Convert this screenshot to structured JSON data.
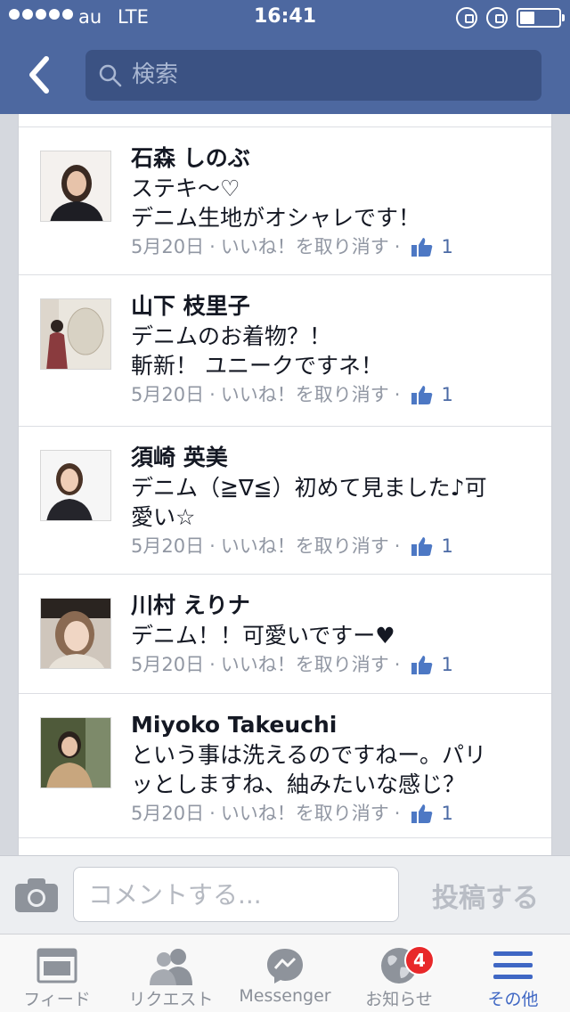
{
  "status_bar": {
    "carrier": "au",
    "network": "LTE",
    "time": "16:41"
  },
  "header": {
    "back_icon": "chevron-left-icon",
    "search_placeholder": "検索"
  },
  "comments": [
    {
      "name": "石森 しのぶ",
      "text": "ステキ〜♡\nデニム生地がオシャレです！",
      "date": "5月20日",
      "unlike_label": "いいね！を取り消す",
      "likes": "1"
    },
    {
      "name": "山下 枝里子",
      "text": "デニムのお着物？！\n斬新！ ユニークですネ！",
      "date": "5月20日",
      "unlike_label": "いいね！を取り消す",
      "likes": "1"
    },
    {
      "name": "須崎 英美",
      "text": "デニム（≧∇≦）初めて見ました♪可\n愛い☆",
      "date": "5月20日",
      "unlike_label": "いいね！を取り消す",
      "likes": "1"
    },
    {
      "name": "川村 えりナ",
      "text": "デニム！！可愛いですー♥",
      "date": "5月20日",
      "unlike_label": "いいね！を取り消す",
      "likes": "1"
    },
    {
      "name": "Miyoko Takeuchi",
      "text": "という事は洗えるのですねー。パリ\nッとしますね、紬みたいな感じ？",
      "date": "5月20日",
      "unlike_label": "いいね！を取り消す",
      "likes": "1"
    }
  ],
  "composer": {
    "placeholder": "コメントする...",
    "post_label": "投稿する"
  },
  "tabbar": {
    "tabs": [
      {
        "label": "フィード",
        "icon": "news-feed-icon"
      },
      {
        "label": "リクエスト",
        "icon": "friend-requests-icon"
      },
      {
        "label": "Messenger",
        "icon": "messenger-icon"
      },
      {
        "label": "お知らせ",
        "icon": "globe-icon",
        "badge": "4"
      },
      {
        "label": "その他",
        "icon": "menu-icon",
        "active": true
      }
    ]
  },
  "colors": {
    "header": "#4d68a0",
    "accent": "#3f67c4",
    "badge": "#e8282a"
  }
}
